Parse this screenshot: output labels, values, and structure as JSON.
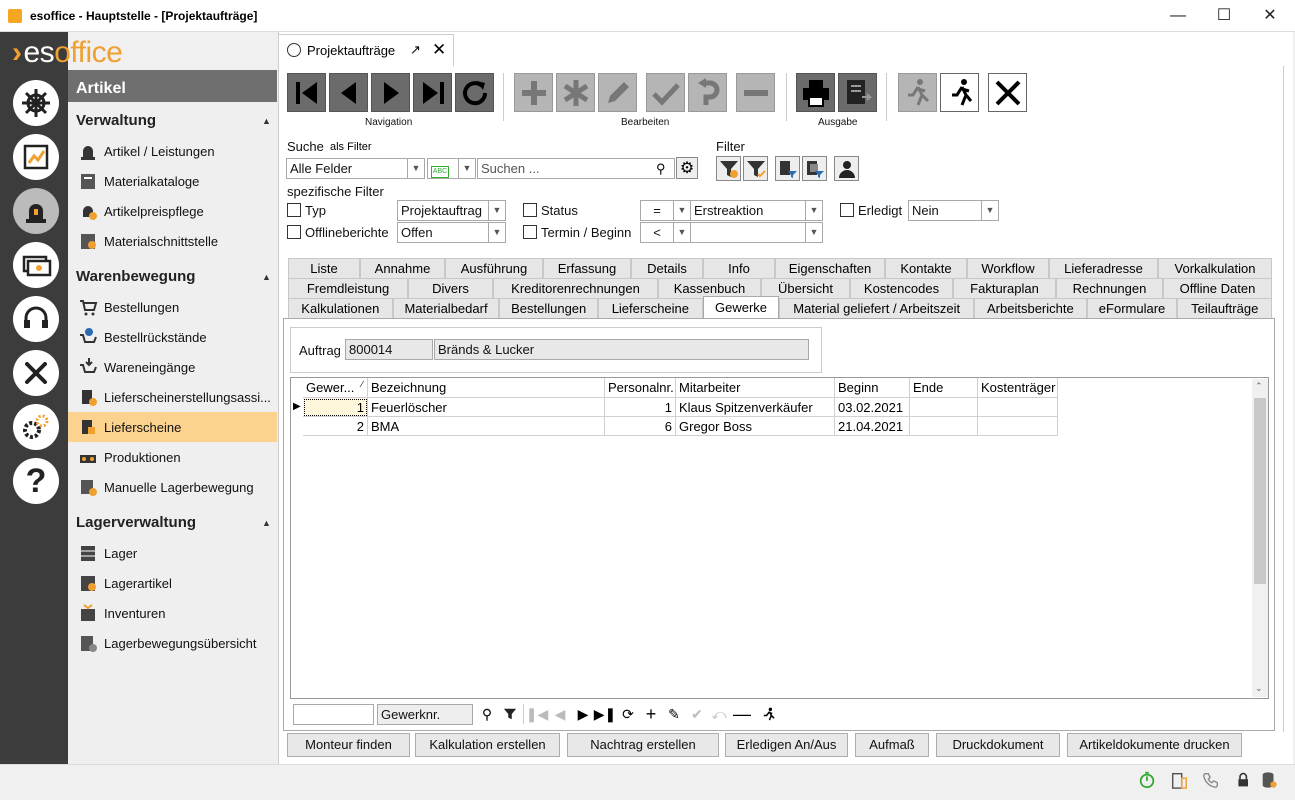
{
  "window": {
    "title": "esoffice - Hauptstelle - [Projektaufträge]"
  },
  "logo": {
    "part1": "es",
    "part2": "office"
  },
  "sidebar": {
    "icons": [
      "helm-icon",
      "grid-chart-icon",
      "siren-icon",
      "money-stack-icon",
      "headset-icon",
      "tools-icon",
      "gears-icon",
      "help-icon"
    ],
    "module_title": "Artikel",
    "groups": [
      {
        "label": "Verwaltung",
        "items": [
          "Artikel / Leistungen",
          "Materialkataloge",
          "Artikelpreispflege",
          "Materialschnittstelle"
        ]
      },
      {
        "label": "Warenbewegung",
        "items": [
          "Bestellungen",
          "Bestellrückstände",
          "Wareneingänge",
          "Lieferscheinerstellungsassi...",
          "Lieferscheine",
          "Produktionen",
          "Manuelle Lagerbewegung"
        ]
      },
      {
        "label": "Lagerverwaltung",
        "items": [
          "Lager",
          "Lagerartikel",
          "Inventuren",
          "Lagerbewegungsübersicht"
        ]
      }
    ],
    "selected_item": "Lieferscheine"
  },
  "doc_tab": {
    "label": "Projektaufträge"
  },
  "toolbar": {
    "groups": {
      "navigation": "Navigation",
      "edit": "Bearbeiten",
      "output": "Ausgabe"
    }
  },
  "search": {
    "label": "Suche",
    "filter_label": "als Filter",
    "field_select": "Alle Felder",
    "search_placeholder": "Suchen ...",
    "filter_title": "Filter",
    "specific_filter_title": "spezifische Filter"
  },
  "filters": {
    "typ_label": "Typ",
    "typ_value": "Projektauftrag",
    "offline_label": "Offlineberichte",
    "offline_value": "Offen",
    "status_label": "Status",
    "status_op": "=",
    "status_value": "Erstreaktion",
    "termin_label": "Termin / Beginn",
    "termin_op": "<",
    "termin_value": "",
    "erledigt_label": "Erledigt",
    "erledigt_value": "Nein"
  },
  "tabs": {
    "row1": [
      "Liste",
      "Annahme",
      "Ausführung",
      "Erfassung",
      "Details",
      "Info",
      "Eigenschaften",
      "Kontakte",
      "Workflow",
      "Lieferadresse",
      "Vorkalkulation"
    ],
    "row2": [
      "Fremdleistung",
      "Divers",
      "Kreditorenrechnungen",
      "Kassenbuch",
      "Übersicht",
      "Kostencodes",
      "Fakturaplan",
      "Rechnungen",
      "Offline Daten"
    ],
    "row3": [
      "Kalkulationen",
      "Materialbedarf",
      "Bestellungen",
      "Lieferscheine",
      "Gewerke",
      "Material geliefert / Arbeitszeit",
      "Arbeitsberichte",
      "eFormulare",
      "Teilaufträge"
    ],
    "active": "Gewerke"
  },
  "auftrag": {
    "label": "Auftrag",
    "number": "800014",
    "name": "Bränds & Lucker"
  },
  "grid": {
    "columns": [
      "Gewer...",
      "Bezeichnung",
      "Personalnr.",
      "Mitarbeiter",
      "Beginn",
      "Ende",
      "Kostenträger"
    ],
    "rows": [
      [
        "1",
        "Feuerlöscher",
        "1",
        "Klaus Spitzenverkäufer",
        "03.02.2021",
        "",
        ""
      ],
      [
        "2",
        "BMA",
        "6",
        "Gregor Boss",
        "21.04.2021",
        "",
        ""
      ]
    ]
  },
  "grid_nav": {
    "search_value": "",
    "column_value": "Gewerknr."
  },
  "actions": [
    "Monteur finden",
    "Kalkulation erstellen",
    "Nachtrag erstellen",
    "Erledigen An/Aus",
    "Aufmaß",
    "Druckdokument",
    "Artikeldokumente drucken"
  ]
}
